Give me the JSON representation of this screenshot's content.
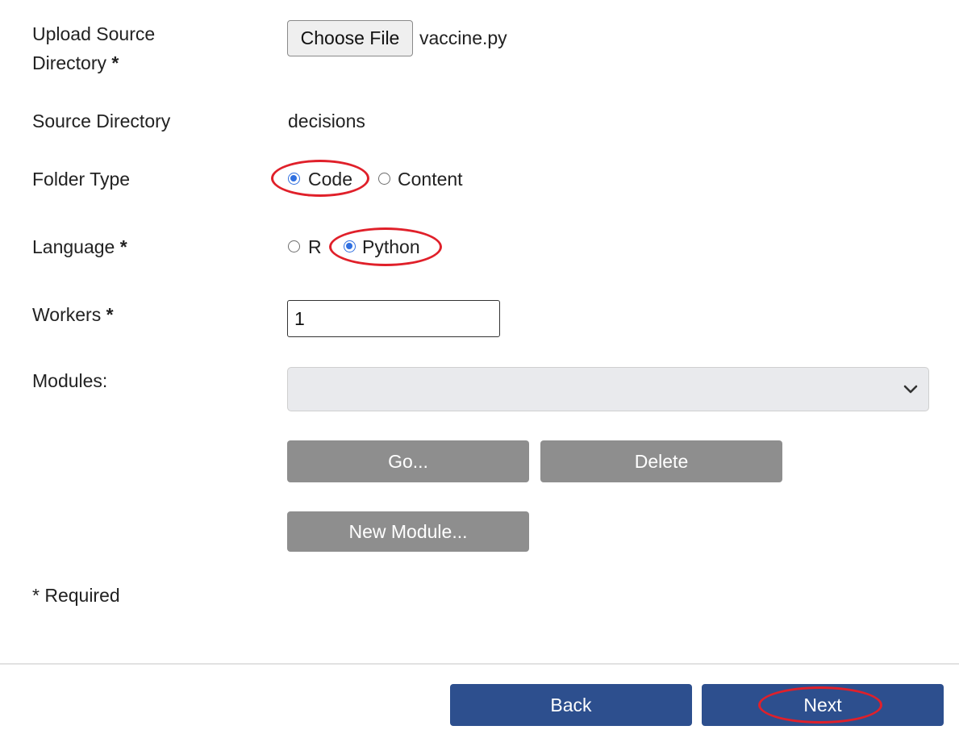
{
  "form": {
    "upload": {
      "label": "Upload Source",
      "label_line2": "Directory",
      "required_mark": "*",
      "choose_file_label": "Choose File",
      "file_name": "vaccine.py"
    },
    "source_directory": {
      "label": "Source Directory",
      "value": "decisions"
    },
    "folder_type": {
      "label": "Folder Type",
      "options": [
        {
          "label": "Code",
          "checked": true
        },
        {
          "label": "Content",
          "checked": false
        }
      ]
    },
    "language": {
      "label": "Language",
      "required_mark": "*",
      "options": [
        {
          "label": "R",
          "checked": false
        },
        {
          "label": "Python",
          "checked": true
        }
      ]
    },
    "workers": {
      "label": "Workers",
      "required_mark": "*",
      "value": "1"
    },
    "modules": {
      "label": "Modules:",
      "selected": "",
      "go_label": "Go...",
      "delete_label": "Delete",
      "new_module_label": "New Module..."
    },
    "required_note": "* Required"
  },
  "footer": {
    "back_label": "Back",
    "next_label": "Next"
  },
  "colors": {
    "primary_button": "#2d4f8e",
    "secondary_button": "#8e8e8e",
    "annotation": "#e0202a",
    "radio_checked": "#2f6fe0"
  }
}
